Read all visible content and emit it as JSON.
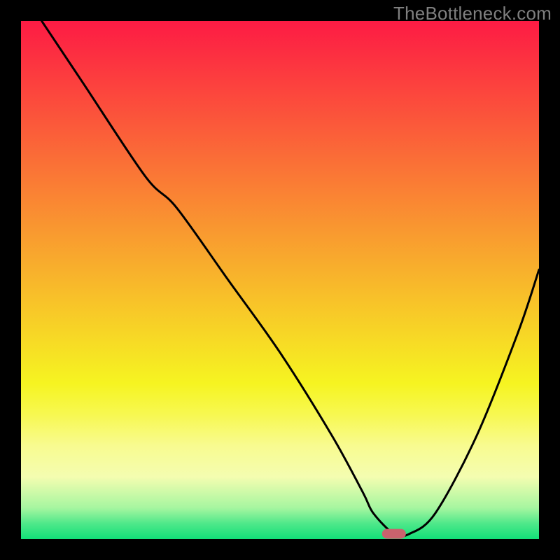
{
  "watermark": "TheBottleneck.com",
  "colors": {
    "background": "#000000",
    "watermark_text": "#7f7f7f",
    "curve_stroke": "#000000",
    "marker_fill": "#c9626d",
    "gradient_stops": [
      {
        "offset": "0.00",
        "color": "#fd1b44"
      },
      {
        "offset": "0.10",
        "color": "#fc3a3f"
      },
      {
        "offset": "0.20",
        "color": "#fb593a"
      },
      {
        "offset": "0.30",
        "color": "#fa7835"
      },
      {
        "offset": "0.40",
        "color": "#f99730"
      },
      {
        "offset": "0.50",
        "color": "#f8b62b"
      },
      {
        "offset": "0.60",
        "color": "#f7d526"
      },
      {
        "offset": "0.70",
        "color": "#f6f421"
      },
      {
        "offset": "0.76",
        "color": "#f7f851"
      },
      {
        "offset": "0.82",
        "color": "#f8fb90"
      },
      {
        "offset": "0.88",
        "color": "#f4fdb0"
      },
      {
        "offset": "0.94",
        "color": "#a6f6a0"
      },
      {
        "offset": "0.97",
        "color": "#4fe88a"
      },
      {
        "offset": "1.00",
        "color": "#12df78"
      }
    ]
  },
  "chart_data": {
    "type": "line",
    "title": "",
    "xlabel": "",
    "ylabel": "",
    "xlim": [
      0,
      100
    ],
    "ylim": [
      0,
      100
    ],
    "series": [
      {
        "name": "curve",
        "x": [
          4,
          12,
          24,
          30,
          40,
          50,
          60,
          66,
          68,
          72,
          75,
          80,
          88,
          96,
          100
        ],
        "y": [
          100,
          88,
          70,
          64,
          50,
          36,
          20,
          9,
          5,
          1,
          1,
          5,
          20,
          40,
          52
        ]
      }
    ],
    "marker": {
      "x": 72,
      "y": 1
    }
  }
}
